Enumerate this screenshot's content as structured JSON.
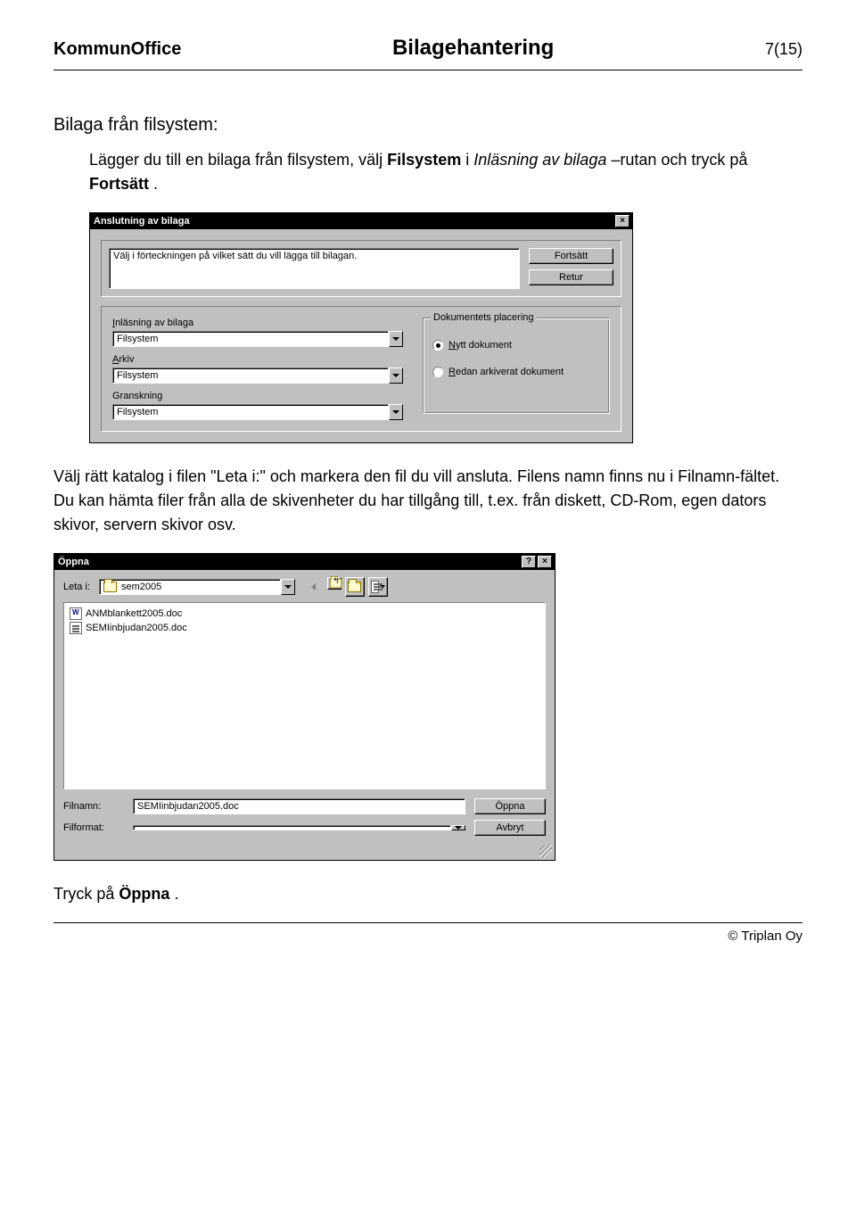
{
  "header": {
    "left": "KommunOffice",
    "center": "Bilagehantering",
    "right": "7(15)"
  },
  "section_title": "Bilaga från filsystem:",
  "intro": {
    "pre": "Lägger du till en bilaga från filsystem, välj ",
    "bold1": "Filsystem",
    "mid1": " i ",
    "italic1": "Inläsning av bilaga",
    "mid2": " –rutan och tryck på ",
    "bold2": "Fortsätt",
    "end": "."
  },
  "dialog1": {
    "title": "Anslutning av bilaga",
    "instruction": "Välj i förteckningen på vilket sätt du vill lägga till bilagan.",
    "buttons": {
      "continue": "Fortsätt",
      "return": "Retur"
    },
    "fields": {
      "inlasning_label": "Inläsning av bilaga",
      "inlasning_value": "Filsystem",
      "arkiv_label": "Arkiv",
      "arkiv_value": "Filsystem",
      "granskning_label": "Granskning",
      "granskning_value": "Filsystem"
    },
    "groupbox": {
      "title": "Dokumentets placering",
      "option1": "Nytt dokument",
      "option2": "Redan arkiverat dokument",
      "selected": "option1"
    }
  },
  "paragraph2": "Välj rätt katalog i filen \"Leta i:\" och markera den fil du vill ansluta. Filens namn finns nu i Filnamn-fältet. Du kan hämta filer från alla de skivenheter du har tillgång till, t.ex. från diskett, CD-Rom, egen dators skivor, servern skivor osv.",
  "dialog2": {
    "title": "Öppna",
    "lookin_label": "Leta i:",
    "lookin_value": "sem2005",
    "files": [
      {
        "name": "ANMblankett2005.doc",
        "icon": "word"
      },
      {
        "name": "SEMIinbjudan2005.doc",
        "icon": "doc"
      }
    ],
    "filename_label": "Filnamn:",
    "filename_value": "SEMIinbjudan2005.doc",
    "filetype_label": "Filformat:",
    "filetype_value": "",
    "open_btn": "Öppna",
    "cancel_btn": "Avbryt"
  },
  "closing": {
    "pre": "Tryck på ",
    "bold": "Öppna",
    "end": "."
  },
  "footer": "© Triplan Oy"
}
